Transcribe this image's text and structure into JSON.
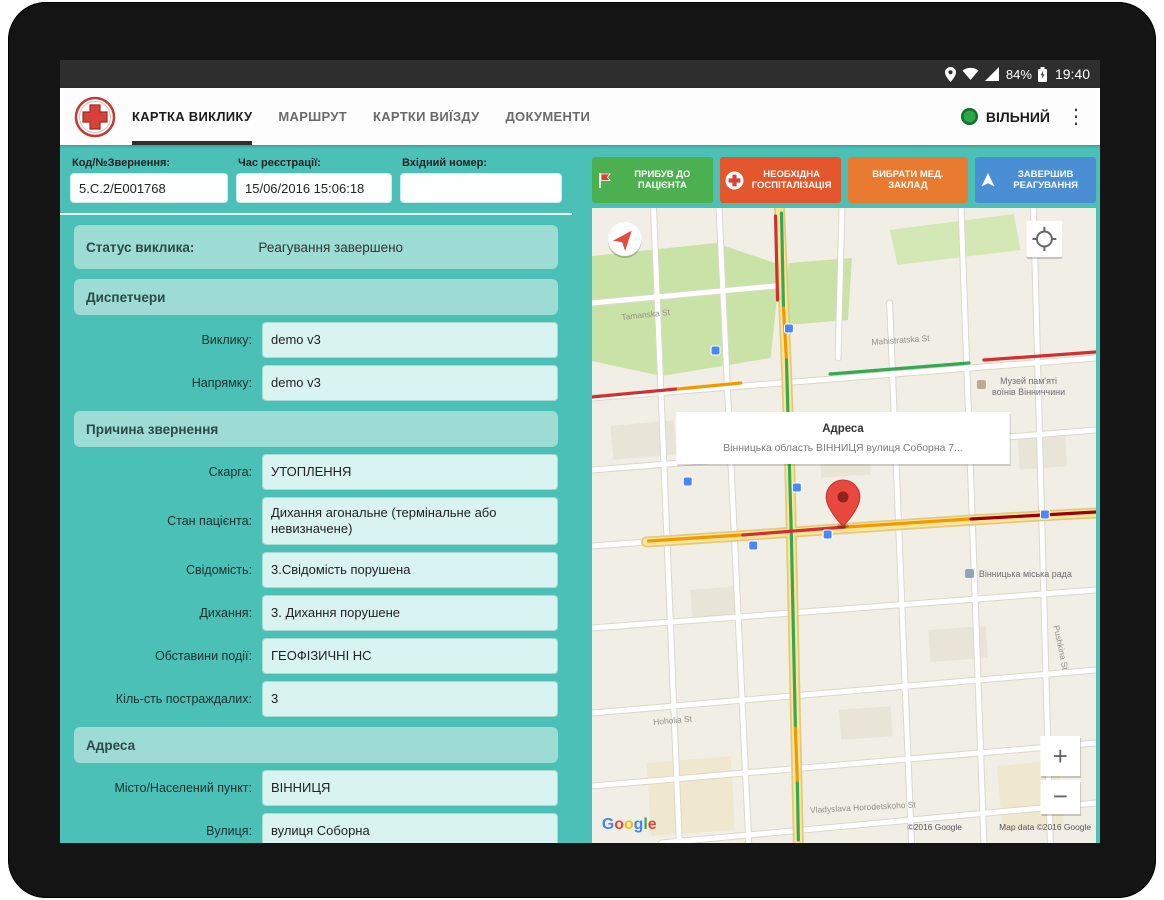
{
  "status_bar": {
    "battery": "84%",
    "time": "19:40"
  },
  "toolbar": {
    "tabs": [
      {
        "label": "КАРТКА ВИКЛИКУ"
      },
      {
        "label": "МАРШРУТ"
      },
      {
        "label": "КАРТКИ ВИЇЗДУ"
      },
      {
        "label": "ДОКУМЕНТИ"
      }
    ],
    "status_label": "ВІЛЬНИЙ"
  },
  "icons": {
    "overflow": "⋮"
  },
  "form": {
    "header_fields": [
      {
        "label": "Код/№Звернення:",
        "value": "5.С.2/Е001768"
      },
      {
        "label": "Час реєстрації:",
        "value": "15/06/2016 15:06:18"
      },
      {
        "label": "Вхідний номер:",
        "value": ""
      }
    ],
    "status": {
      "label": "Статус виклика:",
      "value": "Реагування завершено"
    },
    "sections": [
      {
        "title": "Диспетчери",
        "rows": [
          {
            "label": "Виклику:",
            "value": "demo v3"
          },
          {
            "label": "Напрямку:",
            "value": "demo v3"
          }
        ]
      },
      {
        "title": "Причина звернення",
        "rows": [
          {
            "label": "Скарга:",
            "value": "УТОПЛЕННЯ"
          },
          {
            "label": "Стан пацієнта:",
            "value": "Дихання агональне (термінальне або невизначене)"
          },
          {
            "label": "Свідомість:",
            "value": "3.Свідомість порушена"
          },
          {
            "label": "Дихання:",
            "value": "3. Дихання порушене"
          },
          {
            "label": "Обставини події:",
            "value": "ГЕОФІЗИЧНІ НС"
          },
          {
            "label": "Кіль-сть постраждалих:",
            "value": "3"
          }
        ]
      },
      {
        "title": "Адреса",
        "rows": [
          {
            "label": "Місто/Населений пункт:",
            "value": "ВІННИЦЯ"
          },
          {
            "label": "Вулиця:",
            "value": "вулиця Соборна"
          }
        ]
      }
    ]
  },
  "actions": [
    {
      "label": "ПРИБУВ ДО ПАЦІЄНТА"
    },
    {
      "label": "НЕОБХІДНА ГОСПІТАЛІЗАЦІЯ"
    },
    {
      "label": "ВИБРАТИ МЕД. ЗАКЛАД"
    },
    {
      "label": "ЗАВЕРШИВ РЕАГУВАННЯ"
    }
  ],
  "map": {
    "info_window": {
      "title": "Адреса",
      "subtitle": "Вінницька область ВІННИЦЯ вулиця Соборна 7..."
    },
    "labels": {
      "street_1": "Tamanska St",
      "street_2": "Mahistratska St",
      "street_3": "Hoholia St",
      "street_4": "Vladyslava Horodetskoho St",
      "street_5": "Pushkina St",
      "museum_line1": "Музей пам'яті",
      "museum_line2": "воїнів Вінниччини",
      "city_hall": "Вінницька міська рада"
    },
    "controls": {
      "zoom_in": "+",
      "zoom_out": "−"
    },
    "logo_letters": [
      "G",
      "o",
      "o",
      "g",
      "l",
      "e"
    ],
    "attribution_left": "©2016 Google",
    "attribution_right": "Map data ©2016 Google"
  }
}
